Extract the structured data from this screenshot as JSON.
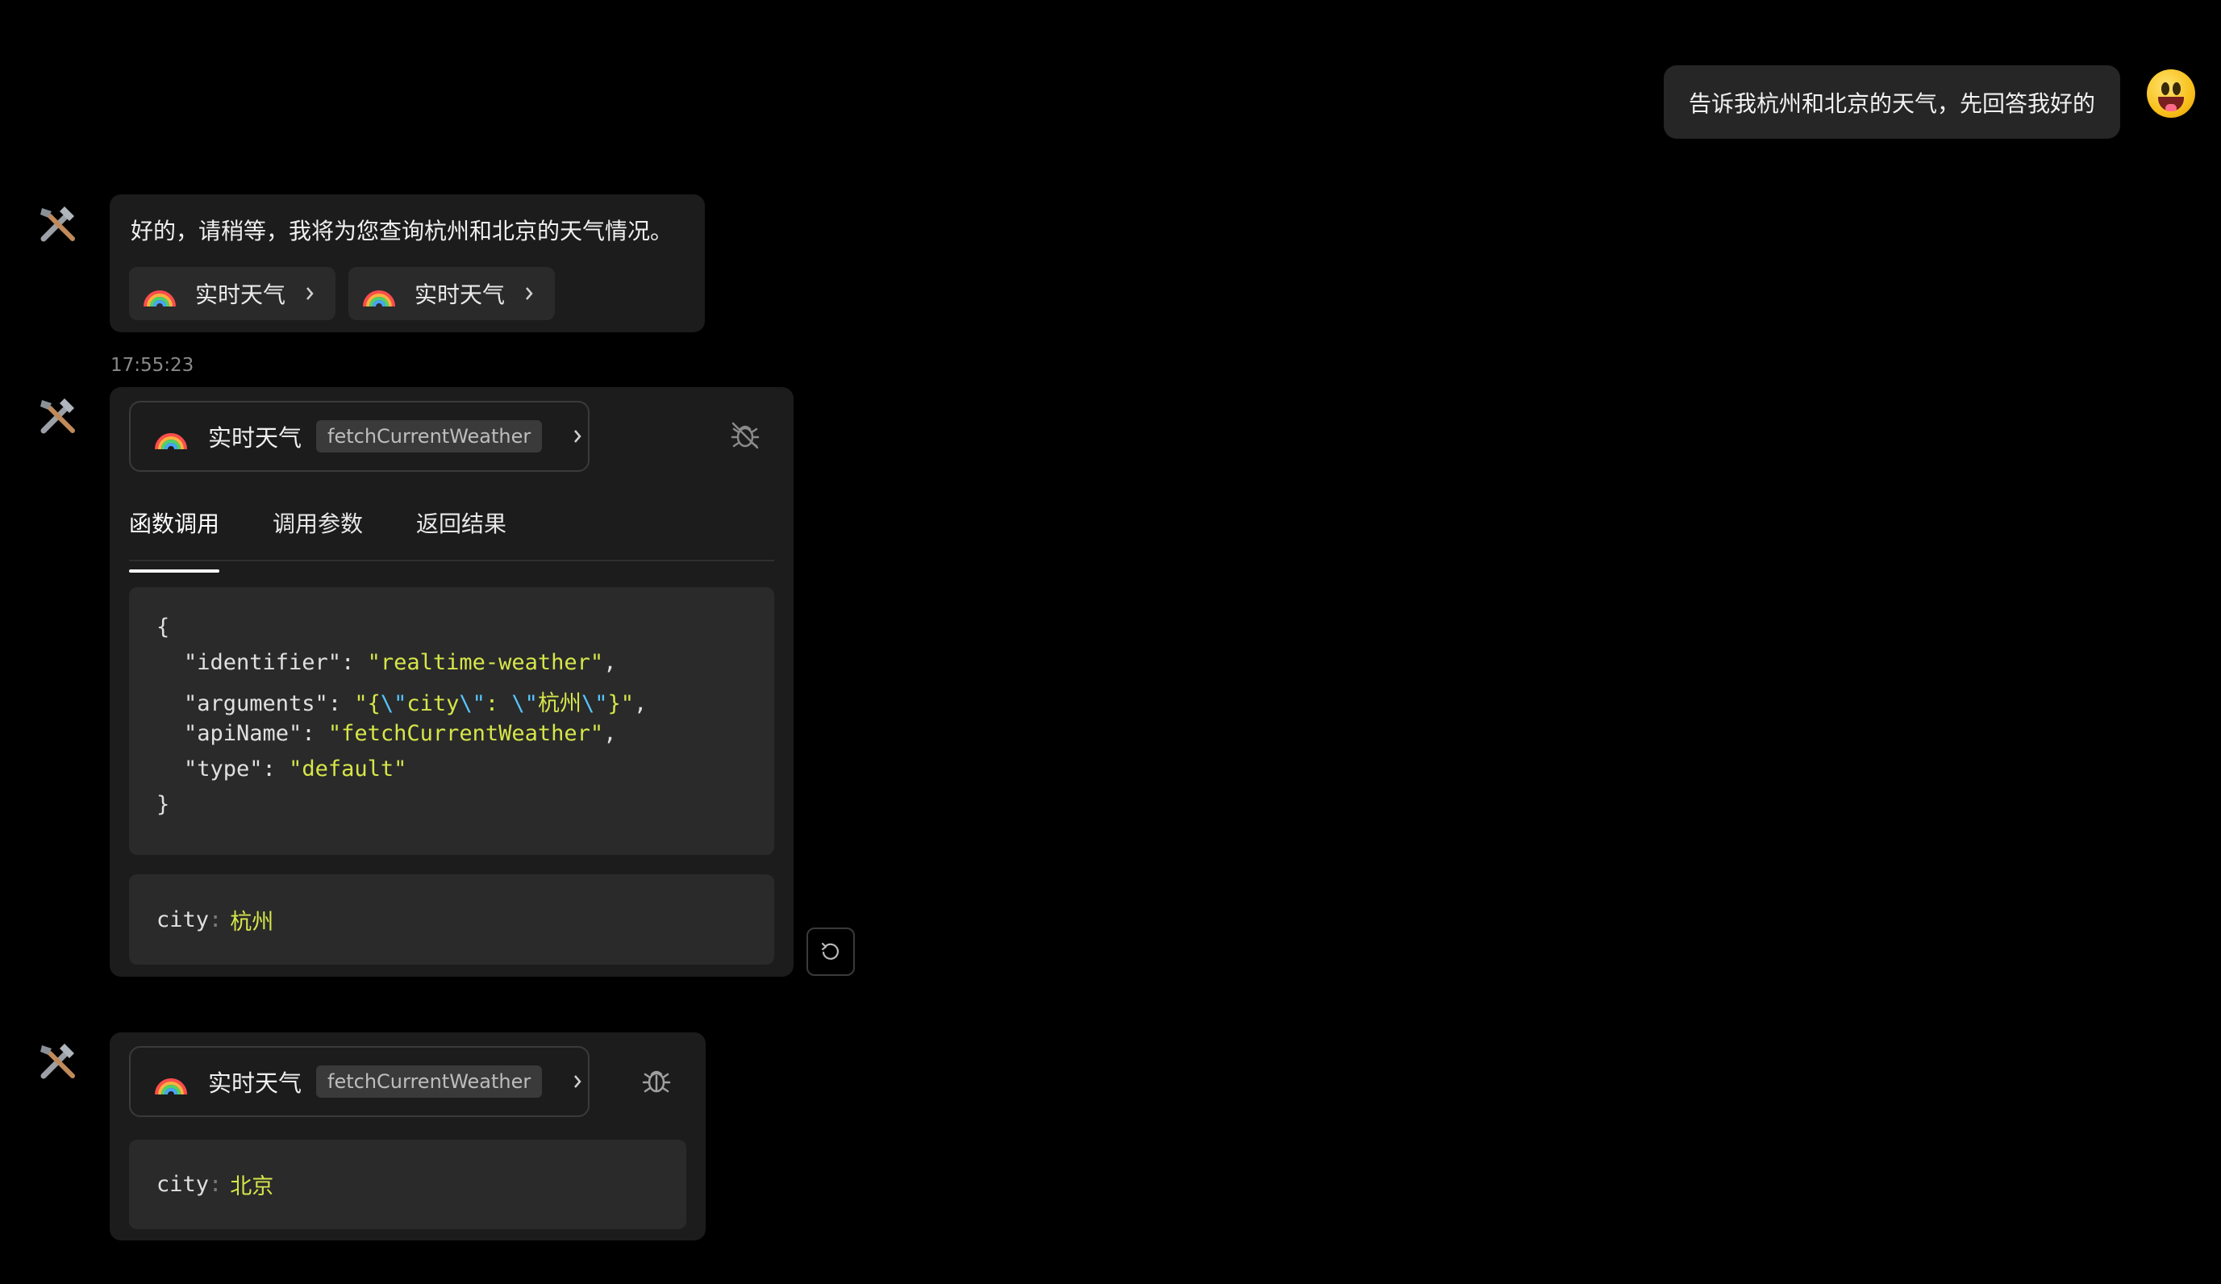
{
  "user_message": {
    "text": "告诉我杭州和北京的天气，先回答我好的"
  },
  "assistant_reply": {
    "text": "好的，请稍等，我将为您查询杭州和北京的天气情况。",
    "plugins": [
      {
        "label": "实时天气",
        "icon": "rainbow-icon"
      },
      {
        "label": "实时天气",
        "icon": "rainbow-icon"
      }
    ],
    "timestamp": "17:55:23"
  },
  "tool_call_1": {
    "name": "实时天气",
    "api_name": "fetchCurrentWeather",
    "debug_state": "debug-off-icon",
    "tabs": [
      "函数调用",
      "调用参数",
      "返回结果"
    ],
    "active_tab": "函数调用",
    "json_open": "{",
    "json_close": "}",
    "fields": [
      {
        "key": "\"identifier\"",
        "value": "\"realtime-weather\""
      },
      {
        "key": "\"arguments\"",
        "value": "\"{\\\"city\\\": \\\"杭州\\\"}\""
      },
      {
        "key": "\"apiName\"",
        "value": "\"fetchCurrentWeather\""
      },
      {
        "key": "\"type\"",
        "value": "\"default\""
      }
    ],
    "arg_key": "city",
    "arg_value": "杭州"
  },
  "tool_call_2": {
    "name": "实时天气",
    "api_name": "fetchCurrentWeather",
    "debug_state": "debug-icon",
    "arg_key": "city",
    "arg_value": "北京"
  },
  "colors": {
    "background": "#000000",
    "bubble": "#1c1c1c",
    "code_bg": "#2a2a2a",
    "string": "#d6e64a",
    "escape": "#56c6ff"
  }
}
